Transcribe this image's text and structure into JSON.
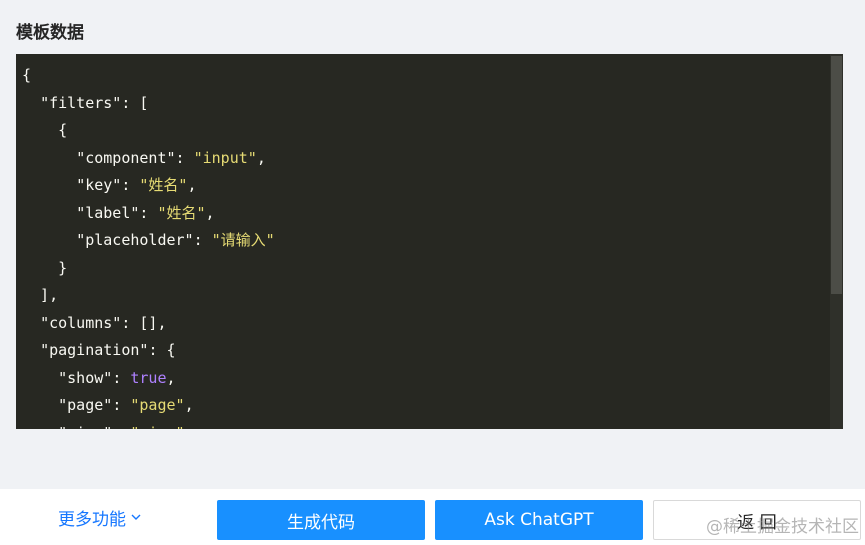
{
  "section": {
    "title": "模板数据"
  },
  "code": {
    "lines": [
      [
        {
          "t": "{",
          "c": "p"
        }
      ],
      [
        {
          "t": "  ",
          "c": "p"
        },
        {
          "t": "\"filters\"",
          "c": "k"
        },
        {
          "t": ": [",
          "c": "p"
        }
      ],
      [
        {
          "t": "    {",
          "c": "p"
        }
      ],
      [
        {
          "t": "      ",
          "c": "p"
        },
        {
          "t": "\"component\"",
          "c": "k"
        },
        {
          "t": ": ",
          "c": "p"
        },
        {
          "t": "\"input\"",
          "c": "s"
        },
        {
          "t": ",",
          "c": "p"
        }
      ],
      [
        {
          "t": "      ",
          "c": "p"
        },
        {
          "t": "\"key\"",
          "c": "k"
        },
        {
          "t": ": ",
          "c": "p"
        },
        {
          "t": "\"姓名\"",
          "c": "s"
        },
        {
          "t": ",",
          "c": "p"
        }
      ],
      [
        {
          "t": "      ",
          "c": "p"
        },
        {
          "t": "\"label\"",
          "c": "k"
        },
        {
          "t": ": ",
          "c": "p"
        },
        {
          "t": "\"姓名\"",
          "c": "s"
        },
        {
          "t": ",",
          "c": "p"
        }
      ],
      [
        {
          "t": "      ",
          "c": "p"
        },
        {
          "t": "\"placeholder\"",
          "c": "k"
        },
        {
          "t": ": ",
          "c": "p"
        },
        {
          "t": "\"请输入\"",
          "c": "s"
        }
      ],
      [
        {
          "t": "    }",
          "c": "p"
        }
      ],
      [
        {
          "t": "  ],",
          "c": "p"
        }
      ],
      [
        {
          "t": "  ",
          "c": "p"
        },
        {
          "t": "\"columns\"",
          "c": "k"
        },
        {
          "t": ": [],",
          "c": "p"
        }
      ],
      [
        {
          "t": "  ",
          "c": "p"
        },
        {
          "t": "\"pagination\"",
          "c": "k"
        },
        {
          "t": ": {",
          "c": "p"
        }
      ],
      [
        {
          "t": "    ",
          "c": "p"
        },
        {
          "t": "\"show\"",
          "c": "k"
        },
        {
          "t": ": ",
          "c": "p"
        },
        {
          "t": "true",
          "c": "b"
        },
        {
          "t": ",",
          "c": "p"
        }
      ],
      [
        {
          "t": "    ",
          "c": "p"
        },
        {
          "t": "\"page\"",
          "c": "k"
        },
        {
          "t": ": ",
          "c": "p"
        },
        {
          "t": "\"page\"",
          "c": "s"
        },
        {
          "t": ",",
          "c": "p"
        }
      ],
      [
        {
          "t": "    ",
          "c": "p"
        },
        {
          "t": "\"size\"",
          "c": "k"
        },
        {
          "t": ": ",
          "c": "p"
        },
        {
          "t": "\"size\"",
          "c": "s"
        },
        {
          "t": ",",
          "c": "p"
        }
      ]
    ]
  },
  "footer": {
    "more_label": "更多功能",
    "generate_label": "生成代码",
    "chatgpt_label": "Ask ChatGPT",
    "back_label": "返 回"
  },
  "watermark": "@稀土掘金技术社区",
  "colors": {
    "editor_bg": "#272822",
    "key": "#f8f8f2",
    "string": "#e6db74",
    "boolean": "#ae81ff",
    "primary": "#1890ff",
    "link": "#1677ff"
  },
  "icons": {
    "more_chevron": "chevron-down-icon"
  }
}
